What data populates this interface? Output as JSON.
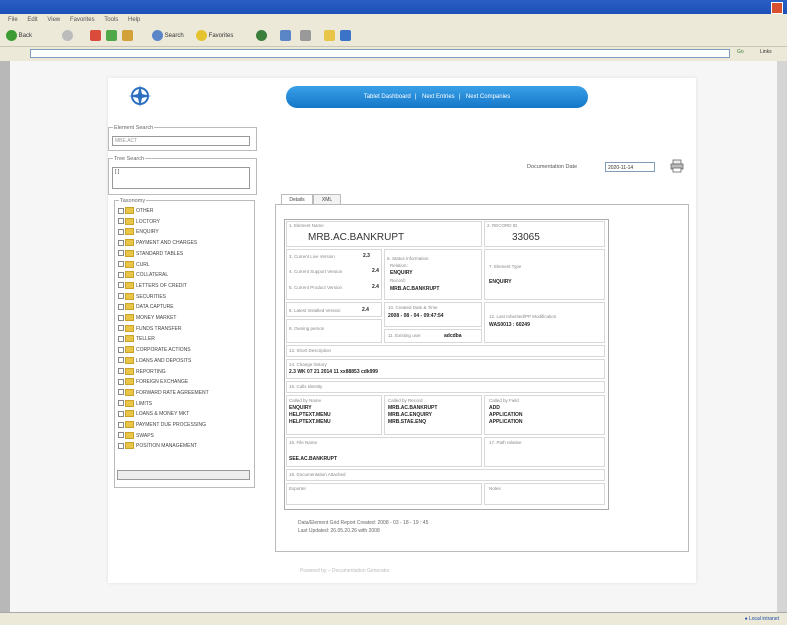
{
  "browser": {
    "menus": [
      "File",
      "Edit",
      "View",
      "Favorites",
      "Tools",
      "Help"
    ],
    "back_label": "Back",
    "search_label": "Search",
    "favorites_label": "Favorites",
    "go_label": "Go",
    "links_label": "Links"
  },
  "page": {
    "nav": [
      "Tablet Dashboard",
      "Next Entries",
      "Next Companies"
    ],
    "element_search_label": "Element Search",
    "element_search_value": "MBE.ACT",
    "tree_search_label": "Tree Search",
    "tree_search_value": "[ ]",
    "taxonomy_label": "Taxonomy",
    "tree_items": [
      "OTHER",
      "LOCTORY",
      "ENQUIRY",
      "PAYMENT AND CHARGES",
      "STANDARD TABLES",
      "CURL",
      "COLLATERAL",
      "LETTERS OF CREDIT",
      "SECURITIES",
      "DATA CAPTURE",
      "MONEY MARKET",
      "FUNDS TRANSFER",
      "TELLER",
      "CORPORATE ACTIONS",
      "LOANS AND DEPOSITS",
      "REPORTING",
      "FOREIGN EXCHANGE",
      "FORWARD RATE AGREEMENT",
      "LIMITS",
      "LOANS & MONEY MKT",
      "PAYMENT DUE PROCESSING",
      "SWAPS",
      "POSITION MANAGEMENT"
    ],
    "doc_date_label": "Documentation Date",
    "doc_date_value": "2020-11-14",
    "tabs": [
      "Details",
      "XML"
    ],
    "footer": "Powered by – Documentation Generator"
  },
  "form": {
    "element_name_label": "1. Element Name",
    "element_name_value": "MRB.AC.BANKRUPT",
    "record_id_label": "2. RECORD ID",
    "record_id_value": "33065",
    "version_label_1": "3. Current Live Version",
    "version_value_1": "2.3",
    "version_label_2": "4. Current Support Version",
    "version_value_2": "2.4",
    "version_label_3": "5. Current Product Version",
    "version_value_3": "2.4",
    "status_label": "6. Status Information",
    "status_values": [
      "Relation:",
      "ENQUIRY",
      "Record:",
      "MRB.AC.BANKRUPT"
    ],
    "element_type_label": "7. Element Type",
    "element_type_value": "ENQUIRY",
    "latest_version_label": "8. Latest Installed Version",
    "latest_version_value": "2.4",
    "creation_label": "10. Created Date & Time",
    "creation_value": "2008 - 08 - 04 - 09:47:54",
    "last_mod_label": "12. Last Inherited/PP Modification",
    "last_mod_value": "WAS0013 : 60249",
    "owning_label": "9. Owning person",
    "existing_label": "11. Existing user",
    "existing_value": "adcdba",
    "short_desc_label": "13. Short Description",
    "change_hist_label": "14. Change history",
    "change_hist_value": "2.3 WK 07 21 2014 11 xx88853 cdk999",
    "calls_label": "15. Calls Identity",
    "called_by_label": "Called by Name",
    "called_by_values": [
      "ENQUIRY",
      "HELPTEXT.MENU",
      "HELPTEXT.MENU"
    ],
    "called_record_label": "Called by Record",
    "called_record_values": [
      "MRB.AC.BANKRUPT",
      "MRB.AC.ENQUIRY",
      "MRB.STAE.ENQ"
    ],
    "called_field_label": "Called by Field",
    "called_field_values": [
      "ADD",
      "APPLICATION",
      "APPLICATION"
    ],
    "file_name_label": "16. File Name",
    "file_name_value": "SEE.AC.BANKRUPT",
    "path_label": "17. Path relative",
    "doc_label": "18. Documentation Attached",
    "doc_sub_1": "Exporter",
    "doc_sub_2": "Notes",
    "note_1": "Data/Element Grid  Report Created: 2008 - 03 - 18 - 19 : 45",
    "note_2": "Last Updated: 26.05.20.26 with 2008"
  }
}
